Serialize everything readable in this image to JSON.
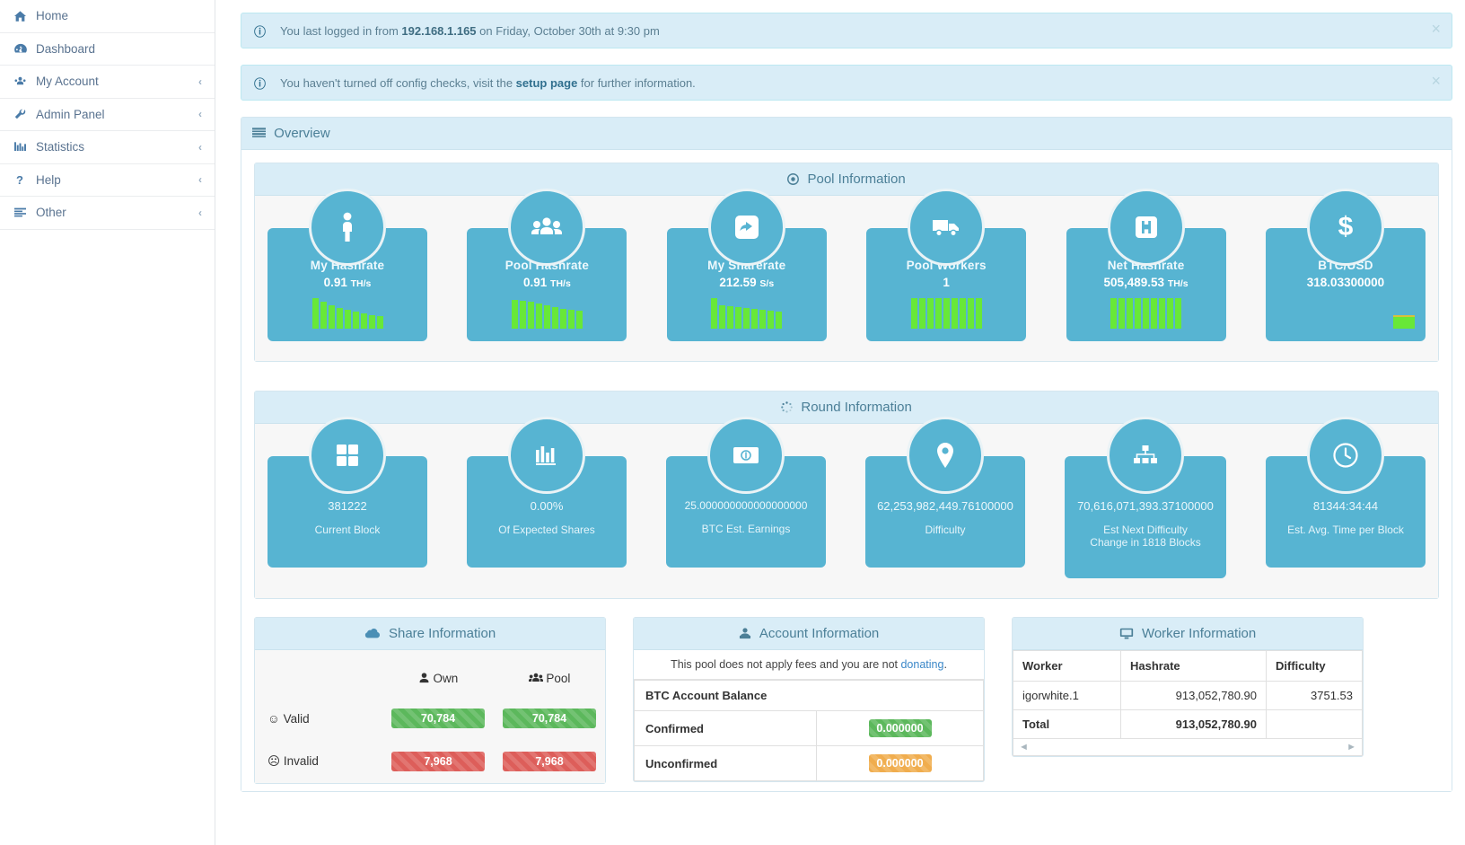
{
  "sidebar": {
    "items": [
      {
        "label": "Home",
        "icon": "home-icon",
        "glyph": "⌂",
        "caret": ""
      },
      {
        "label": "Dashboard",
        "icon": "dashboard-icon",
        "glyph": "◔",
        "caret": ""
      },
      {
        "label": "My Account",
        "icon": "user-group-icon",
        "glyph": "♟",
        "caret": "‹"
      },
      {
        "label": "Admin Panel",
        "icon": "wrench-icon",
        "glyph": "⚒",
        "caret": "‹"
      },
      {
        "label": "Statistics",
        "icon": "bar-chart-icon",
        "glyph": "█",
        "caret": "‹"
      },
      {
        "label": "Help",
        "icon": "question-icon",
        "glyph": "?",
        "caret": "‹"
      },
      {
        "label": "Other",
        "icon": "list-icon",
        "glyph": "≡",
        "caret": "‹"
      }
    ]
  },
  "alerts": [
    {
      "icon": "info-icon",
      "prefix": "You last logged in from ",
      "strong": "192.168.1.165",
      "suffix": " on Friday, October 30th at 9:30 pm",
      "close_label": "×"
    },
    {
      "icon": "info-icon",
      "prefix": "You haven't turned off config checks, visit the ",
      "link": "setup page",
      "suffix": " for further information.",
      "close_label": "×"
    }
  ],
  "overview": {
    "title": "Overview",
    "icon": "list-lines-icon"
  },
  "pool_information": {
    "title": "Pool Information",
    "icon": "target-icon",
    "tiles": [
      {
        "title": "My Hashrate",
        "value": "0.91",
        "unit": "TH/s",
        "icon": "person-icon",
        "glyph": "\u0001",
        "bars": [
          34,
          30,
          26,
          23,
          21,
          19,
          17,
          15,
          14
        ]
      },
      {
        "title": "Pool Hashrate",
        "value": "0.91",
        "unit": "TH/s",
        "icon": "people-icon",
        "glyph": "\u0002",
        "bars": [
          32,
          31,
          30,
          28,
          26,
          24,
          22,
          21,
          20
        ]
      },
      {
        "title": "My Sharerate",
        "value": "212.59",
        "unit": "S/s",
        "icon": "share-icon",
        "glyph": "\u0003",
        "bars": [
          34,
          26,
          25,
          24,
          23,
          22,
          21,
          20,
          19
        ]
      },
      {
        "title": "Pool Workers",
        "value": "1",
        "unit": "",
        "icon": "truck-icon",
        "glyph": "\u0004",
        "bars": [
          34,
          34,
          34,
          34,
          34,
          34,
          34,
          34,
          34
        ]
      },
      {
        "title": "Net Hashrate",
        "value": "505,489.53",
        "unit": "TH/s",
        "icon": "hospital-h-icon",
        "glyph": "\u0005",
        "bars": [
          34,
          34,
          34,
          34,
          34,
          34,
          34,
          34,
          34
        ]
      },
      {
        "title": "BTC/USD",
        "value": "318.03300000",
        "unit": "",
        "icon": "dollar-icon",
        "glyph": "$",
        "bars": []
      }
    ]
  },
  "round_information": {
    "title": "Round Information",
    "icon": "spinner-icon",
    "tiles": [
      {
        "value": "381222",
        "label": "Current Block",
        "icon": "grid-squares-icon"
      },
      {
        "value": "0.00%",
        "label": "Of Expected Shares",
        "icon": "bar-chart-icon"
      },
      {
        "value": "25.000000000000000000",
        "label": "BTC Est. Earnings",
        "icon": "money-bill-icon"
      },
      {
        "value": "62,253,982,449.76100000",
        "label": "Difficulty",
        "icon": "map-pin-icon"
      },
      {
        "value": "70,616,071,393.37100000",
        "label": "Est Next Difficulty\nChange in 1818 Blocks",
        "icon": "sitemap-icon"
      },
      {
        "value": "81344:34:44",
        "label": "Est. Avg. Time per Block",
        "icon": "clock-icon"
      }
    ]
  },
  "share_information": {
    "title": "Share Information",
    "icon": "cloud-icon",
    "columns": [
      {
        "label": "Own",
        "icon": "user-icon"
      },
      {
        "label": "Pool",
        "icon": "users-icon"
      }
    ],
    "rows": [
      {
        "label": "Valid",
        "icon": "smiley-happy-icon",
        "own": "70,784",
        "pool": "70,784",
        "style": "green"
      },
      {
        "label": "Invalid",
        "icon": "smiley-sad-icon",
        "own": "7,968",
        "pool": "7,968",
        "style": "red"
      }
    ]
  },
  "account_information": {
    "title": "Account Information",
    "icon": "user-tie-icon",
    "note_prefix": "This pool does not apply fees and you are not ",
    "note_link": "donating",
    "note_suffix": ".",
    "balance_header": "BTC Account Balance",
    "rows": [
      {
        "label": "Confirmed",
        "value": "0.000000",
        "style": "green"
      },
      {
        "label": "Unconfirmed",
        "value": "0.000000",
        "style": "orange"
      }
    ]
  },
  "worker_information": {
    "title": "Worker Information",
    "icon": "monitor-icon",
    "headers": [
      "Worker",
      "Hashrate",
      "Difficulty"
    ],
    "rows": [
      {
        "worker": "igorwhite.1",
        "hashrate": "913,052,780.90",
        "difficulty": "3751.53"
      },
      {
        "worker": "Total",
        "hashrate": "913,052,780.90",
        "difficulty": ""
      }
    ],
    "scroll_left": "◄",
    "scroll_right": "►"
  },
  "colors": {
    "tile": "#57b4d2",
    "panel_head": "#d9edf7",
    "spark": "#68e838",
    "green": "#5cb85c",
    "red": "#dd5e5a",
    "orange": "#f0ad4e"
  }
}
